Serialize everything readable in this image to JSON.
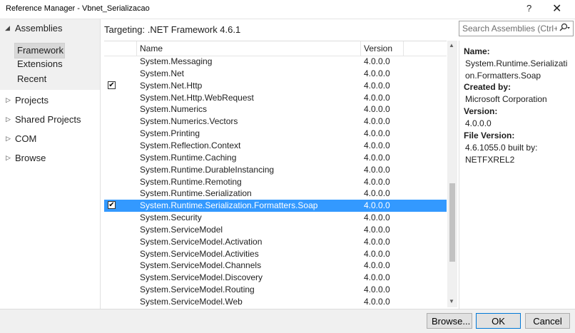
{
  "window": {
    "title": "Reference Manager - Vbnet_Serializacao",
    "help_glyph": "?",
    "close_glyph": "✕"
  },
  "sidebar": {
    "assemblies_label": "Assemblies",
    "sub_items": [
      "Framework",
      "Extensions",
      "Recent"
    ],
    "categories": [
      "Projects",
      "Shared Projects",
      "COM",
      "Browse"
    ]
  },
  "targeting": "Targeting: .NET Framework 4.6.1",
  "search": {
    "placeholder": "Search Assemblies (Ctrl+E)"
  },
  "columns": {
    "name": "Name",
    "version": "Version"
  },
  "rows": [
    {
      "name": "System.Messaging",
      "version": "4.0.0.0",
      "checked": false,
      "selected": false
    },
    {
      "name": "System.Net",
      "version": "4.0.0.0",
      "checked": false,
      "selected": false
    },
    {
      "name": "System.Net.Http",
      "version": "4.0.0.0",
      "checked": true,
      "selected": false
    },
    {
      "name": "System.Net.Http.WebRequest",
      "version": "4.0.0.0",
      "checked": false,
      "selected": false
    },
    {
      "name": "System.Numerics",
      "version": "4.0.0.0",
      "checked": false,
      "selected": false
    },
    {
      "name": "System.Numerics.Vectors",
      "version": "4.0.0.0",
      "checked": false,
      "selected": false
    },
    {
      "name": "System.Printing",
      "version": "4.0.0.0",
      "checked": false,
      "selected": false
    },
    {
      "name": "System.Reflection.Context",
      "version": "4.0.0.0",
      "checked": false,
      "selected": false
    },
    {
      "name": "System.Runtime.Caching",
      "version": "4.0.0.0",
      "checked": false,
      "selected": false
    },
    {
      "name": "System.Runtime.DurableInstancing",
      "version": "4.0.0.0",
      "checked": false,
      "selected": false
    },
    {
      "name": "System.Runtime.Remoting",
      "version": "4.0.0.0",
      "checked": false,
      "selected": false
    },
    {
      "name": "System.Runtime.Serialization",
      "version": "4.0.0.0",
      "checked": false,
      "selected": false
    },
    {
      "name": "System.Runtime.Serialization.Formatters.Soap",
      "version": "4.0.0.0",
      "checked": true,
      "selected": true
    },
    {
      "name": "System.Security",
      "version": "4.0.0.0",
      "checked": false,
      "selected": false
    },
    {
      "name": "System.ServiceModel",
      "version": "4.0.0.0",
      "checked": false,
      "selected": false
    },
    {
      "name": "System.ServiceModel.Activation",
      "version": "4.0.0.0",
      "checked": false,
      "selected": false
    },
    {
      "name": "System.ServiceModel.Activities",
      "version": "4.0.0.0",
      "checked": false,
      "selected": false
    },
    {
      "name": "System.ServiceModel.Channels",
      "version": "4.0.0.0",
      "checked": false,
      "selected": false
    },
    {
      "name": "System.ServiceModel.Discovery",
      "version": "4.0.0.0",
      "checked": false,
      "selected": false
    },
    {
      "name": "System.ServiceModel.Routing",
      "version": "4.0.0.0",
      "checked": false,
      "selected": false
    },
    {
      "name": "System.ServiceModel.Web",
      "version": "4.0.0.0",
      "checked": false,
      "selected": false
    }
  ],
  "details": {
    "name_label": "Name:",
    "name_value": "System.Runtime.Serialization.Formatters.Soap",
    "created_label": "Created by:",
    "created_value": "Microsoft Corporation",
    "version_label": "Version:",
    "version_value": "4.0.0.0",
    "file_version_label": "File Version:",
    "file_version_value": "4.6.1055.0 built by: NETFXREL2"
  },
  "buttons": {
    "browse": "Browse...",
    "ok": "OK",
    "cancel": "Cancel"
  },
  "colors": {
    "selection": "#3399ff",
    "sidebar_bg": "#f0f0f0"
  },
  "icons": {
    "search": "search-icon",
    "checkbox": "checkmark-icon"
  }
}
